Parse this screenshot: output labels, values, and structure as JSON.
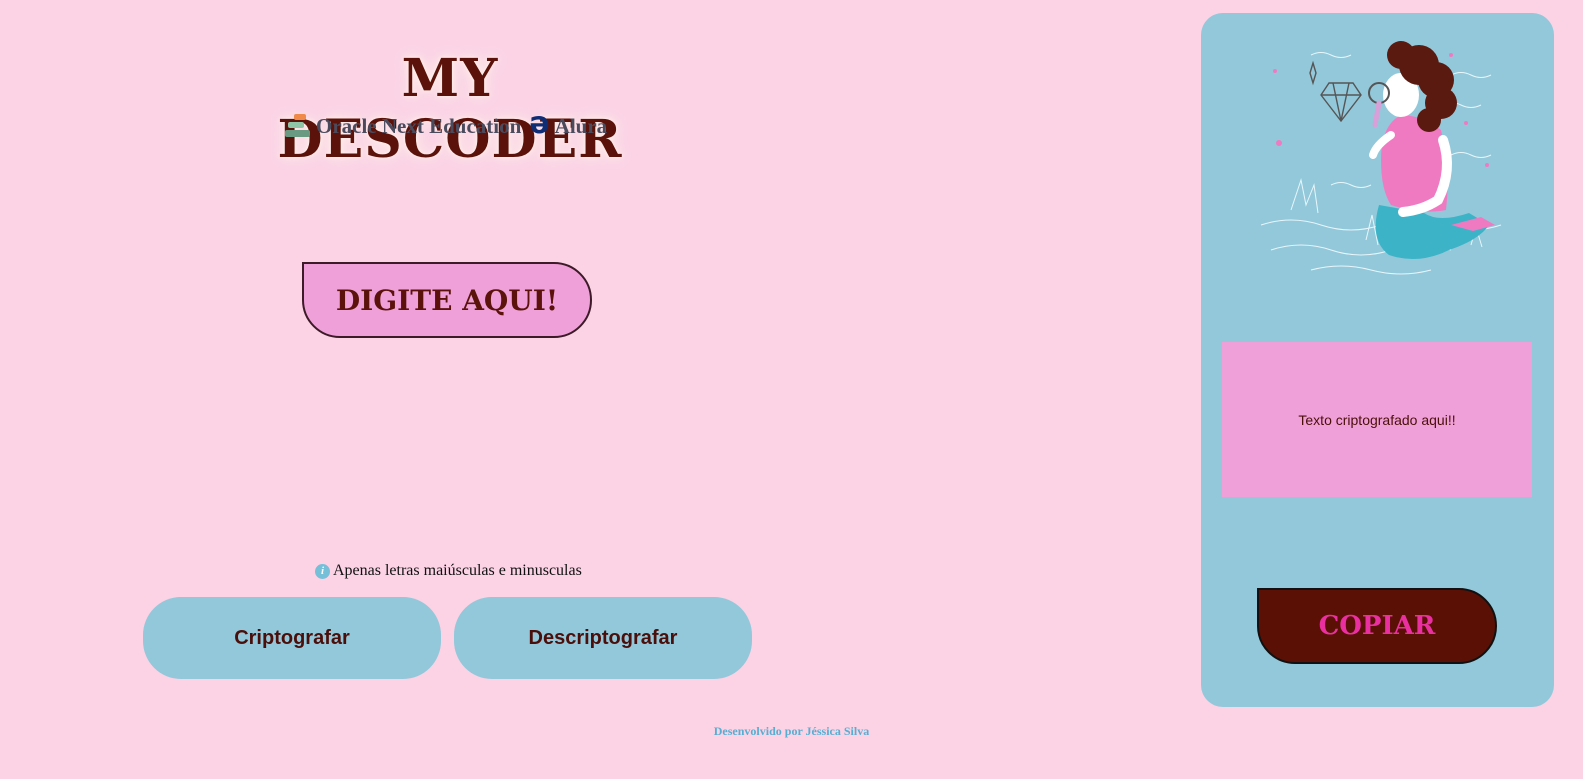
{
  "header": {
    "title": "MY DESCODER",
    "subtitle_one": "Oracle Next Education",
    "subtitle_alura": "Alura"
  },
  "input": {
    "placeholder": "DIGITE AQUI!",
    "value": ""
  },
  "hint": {
    "text": "Apenas letras maiúsculas e minusculas"
  },
  "buttons": {
    "encrypt": "Criptografar",
    "decrypt": "Descriptografar",
    "copy": "COPIAR"
  },
  "output": {
    "text": "Texto criptografado aqui!!"
  },
  "footer": {
    "text": "Desenvolvido por Jéssica Silva"
  },
  "icons": {
    "one_logo": "one-logo-icon",
    "alura_logo": "alura-logo-icon",
    "info": "info-icon",
    "illustration": "woman-magnifying-glass-illustration"
  },
  "colors": {
    "background": "#fbd3e5",
    "accent_pink": "#f0a0d8",
    "accent_blue": "#92c8da",
    "dark_red": "#5a120a",
    "copy_text": "#ea2fa0",
    "footer_text": "#56aed2"
  }
}
